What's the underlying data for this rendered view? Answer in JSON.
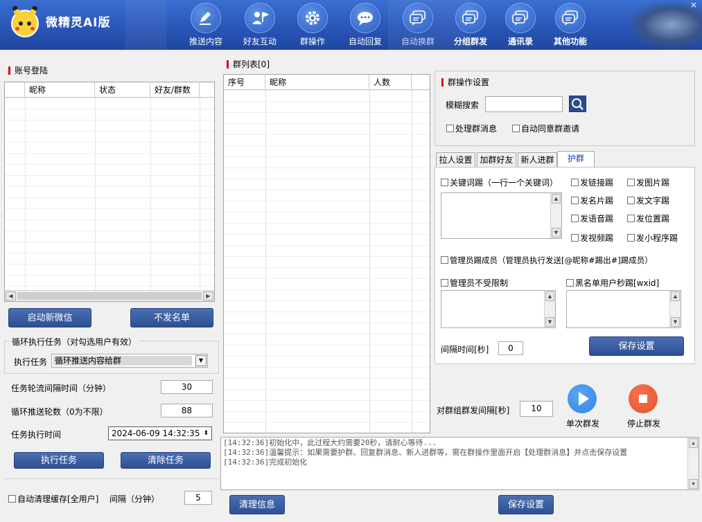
{
  "app": {
    "title": "微精灵AI版"
  },
  "nav": [
    {
      "label": "推送内容",
      "icon": "pen-icon"
    },
    {
      "label": "好友互动",
      "icon": "user-flag-icon"
    },
    {
      "label": "群操作",
      "icon": "gear-icon"
    },
    {
      "label": "自动回复",
      "icon": "chat-bubble-icon"
    },
    {
      "label": "自动换群",
      "icon": "chat-bubbles-icon"
    },
    {
      "label": "分组群发",
      "icon": "chat-bubbles-icon"
    },
    {
      "label": "通讯录",
      "icon": "chat-bubbles-icon"
    },
    {
      "label": "其他功能",
      "icon": "chat-bubbles-icon"
    }
  ],
  "account": {
    "title": "账号登陆",
    "columns": [
      "昵称",
      "状态",
      "好友/群数"
    ],
    "start_btn": "启动新微信",
    "blacklist_btn": "不发名单"
  },
  "loop": {
    "legend": "循环执行任务（对勾选用户有效）",
    "task_label": "执行任务",
    "task_value": "循环推送内容给群",
    "interval_label": "任务轮流间隔时间（分钟）",
    "interval_value": "30",
    "rounds_label": "循环推送轮数（0为不限）",
    "rounds_value": "88",
    "time_label": "任务执行时间",
    "time_value": "2024-06-09 14:32:35",
    "exec_btn": "执行任务",
    "clear_btn": "清除任务"
  },
  "cache": {
    "label": "自动清理缓存[全用户]",
    "interval_label": "间隔（分钟）",
    "interval_value": "5"
  },
  "groups": {
    "title": "群列表[0]",
    "columns": [
      "序号",
      "昵称",
      "人数"
    ]
  },
  "settings": {
    "title": "群操作设置",
    "search_label": "模糊搜索",
    "search_value": "",
    "chk_process": "处理群消息",
    "chk_auto_accept": "自动同意群邀请"
  },
  "tabs": [
    "拉人设置",
    "加群好友",
    "新人进群",
    "护群"
  ],
  "guard": {
    "keyword_kick": "关键词踢（一行一个关键词）",
    "kick_opts": [
      "发链接踢",
      "发图片踢",
      "发名片踢",
      "发文字踢",
      "发语音踢",
      "发位置踢",
      "发视频踢",
      "发小程序踢"
    ],
    "admin_kick": "管理员踢成员（管理员执行发送[@昵称#踢出#]踢成员）",
    "admin_free": "管理员不受限制",
    "blacklist_kick": "黑名单用户秒踢[wxid]",
    "interval_label": "间隔时间[秒]",
    "interval_value": "0",
    "save_btn": "保存设置"
  },
  "send": {
    "interval_label": "对群组群发间隔[秒]",
    "interval_value": "10",
    "single_label": "单次群发",
    "stop_label": "停止群发"
  },
  "log": [
    "[14:32:36]初始化中，此过程大约需要20秒，请耐心等待...",
    "[14:32:36]温馨提示：如果需要护群、回复群消息、新人进群等，需在群操作里面开启【处理群消息】并点击保存设置",
    "[14:32:36]完成初始化"
  ],
  "bottom": {
    "clear_btn": "清理信息",
    "save_btn": "保存设置"
  },
  "colors": {
    "accent": "#2d4f94",
    "header": "#2a56b8",
    "play": "#2f86e6",
    "stop": "#e8502b"
  }
}
